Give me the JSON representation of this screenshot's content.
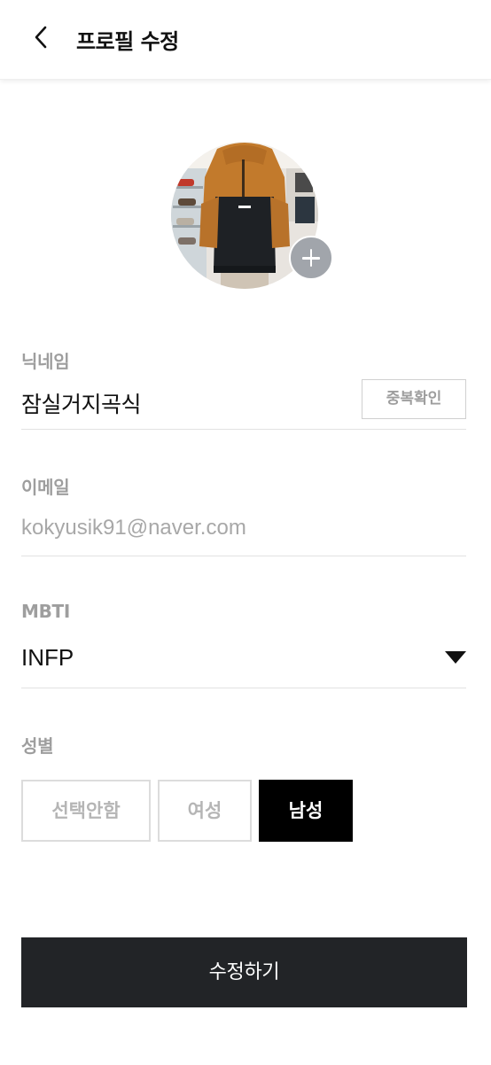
{
  "header": {
    "title": "프로필 수정",
    "back_icon": "chevron-left-icon"
  },
  "profile": {
    "avatar_alt": "profile photo",
    "add_icon": "plus-icon"
  },
  "nickname": {
    "label": "닉네임",
    "value": "잠실거지곡식",
    "check_button": "중복확인"
  },
  "email": {
    "label": "이메일",
    "value": "kokyusik91@naver.com"
  },
  "mbti": {
    "label": "MBTI",
    "selected": "INFP",
    "dropdown_icon": "caret-down-icon"
  },
  "gender": {
    "label": "성별",
    "options": [
      "선택안함",
      "여성",
      "남성"
    ],
    "selected": "남성"
  },
  "submit": {
    "label": "수정하기"
  },
  "colors": {
    "primary_dark": "#222427",
    "selected_bg": "#000000",
    "muted_text": "#9e9e9e",
    "divider": "#e2e2e2",
    "add_badge": "#a1a5ab"
  }
}
